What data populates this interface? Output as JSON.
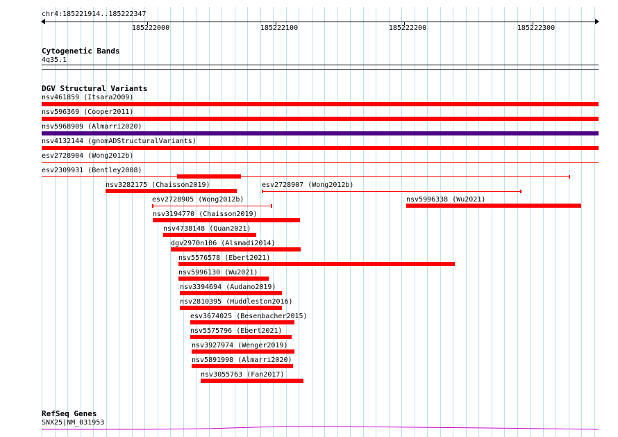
{
  "colors": {
    "gridline": "#bfe0ee",
    "sv_red": "#ff0000",
    "sv_purple": "#4b0082",
    "gene_magenta": "#cc00cc"
  },
  "ruler": {
    "locus": "chr4:185221914..185222347",
    "ticks": [
      "185222000",
      "185222100",
      "185222200",
      "185222300"
    ]
  },
  "cytoband": {
    "title": "Cytogenetic Bands",
    "band": "4q35.1"
  },
  "dgv": {
    "title": "DGV Structural Variants",
    "tracks": [
      {
        "label": "nsv461859 (Itsara2009)"
      },
      {
        "label": "nsv596369 (Cooper2011)"
      },
      {
        "label": "nsv5968909 (Almarri2020)"
      },
      {
        "label": "nsv4132144 (gnomADStructuralVariants)"
      },
      {
        "label": "esv2728904 (Wong2012b)"
      },
      {
        "label": "esv2309931 (Bentley2008)"
      },
      {
        "label": "nsv3282175 (Chaisson2019)"
      },
      {
        "label": "esv2728907 (Wong2012b)"
      },
      {
        "label": "esv2728905 (Wong2012b)"
      },
      {
        "label": "nsv5996338 (Wu2021)"
      },
      {
        "label": "nsv3194770 (Chaisson2019)"
      },
      {
        "label": "nsv4738148 (Quan2021)"
      },
      {
        "label": "dgv2970n106 (Alsmadi2014)"
      },
      {
        "label": "nsv5576578 (Ebert2021)"
      },
      {
        "label": "nsv5996130 (Wu2021)"
      },
      {
        "label": "nsv3394694 (Audano2019)"
      },
      {
        "label": "nsv2810395 (Huddleston2016)"
      },
      {
        "label": "esv3674025 (Besenbacher2015)"
      },
      {
        "label": "nsv5575796 (Ebert2021)"
      },
      {
        "label": "nsv3927974 (Wenger2019)"
      },
      {
        "label": "nsv5891998 (Almarri2020)"
      },
      {
        "label": "nsv3055763 (Fan2017)"
      }
    ]
  },
  "refseq": {
    "title": "RefSeq Genes",
    "gene": "SNX25|NM_031953"
  }
}
